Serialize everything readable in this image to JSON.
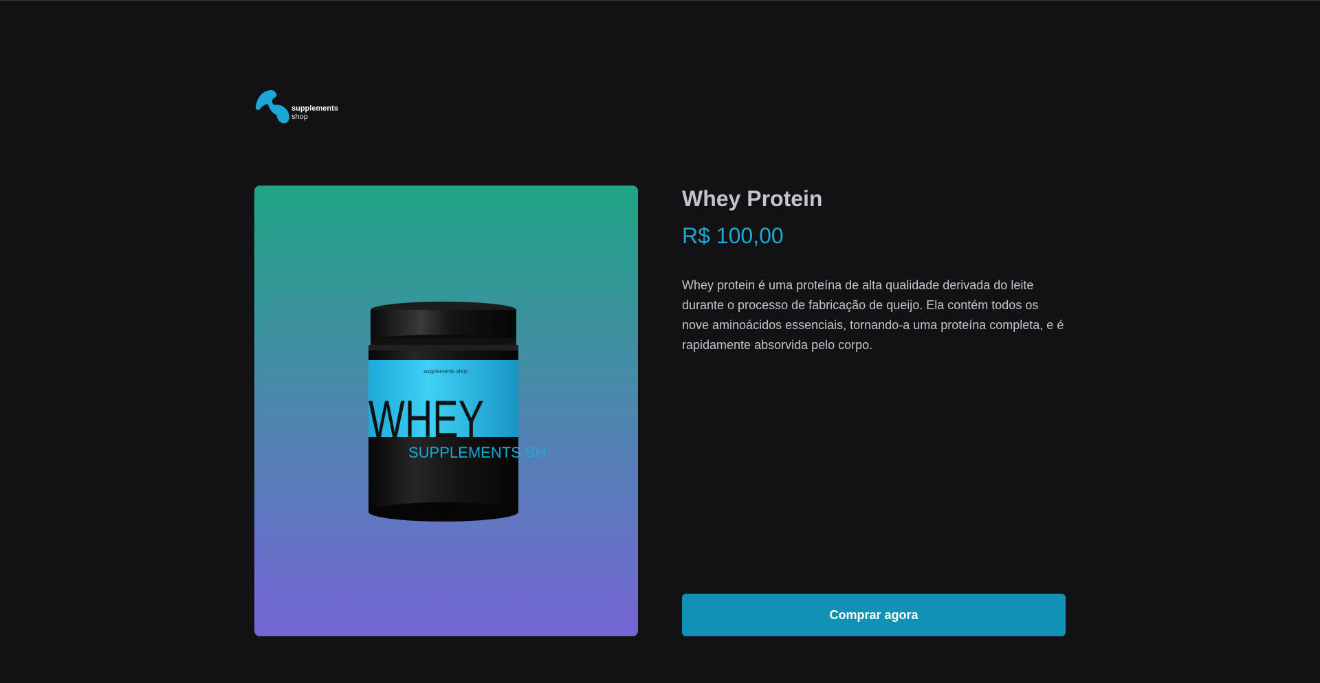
{
  "header": {
    "logo": {
      "icon": "flexed-arm-icon",
      "line1": "supplements",
      "line2": "shop"
    }
  },
  "product": {
    "image": {
      "jar_brand": "supplements shop",
      "jar_title": "WHEY",
      "jar_subtitle": "SUPPLEMENTS SH"
    },
    "title": "Whey Protein",
    "price": "R$ 100,00",
    "description": "Whey protein é uma proteína de alta qualidade derivada do leite durante o processo de fabricação de queijo. Ela contém todos os nove aminoácidos essenciais, tornando-a uma proteína completa, e é rapidamente absorvida pelo corpo.",
    "buy_label": "Comprar agora"
  },
  "colors": {
    "background": "#121214",
    "accent": "#20a8cf",
    "button": "#1191b3",
    "text": "#c4c4cc",
    "gradient_top": "#1fa584",
    "gradient_bottom": "#7465d4"
  }
}
